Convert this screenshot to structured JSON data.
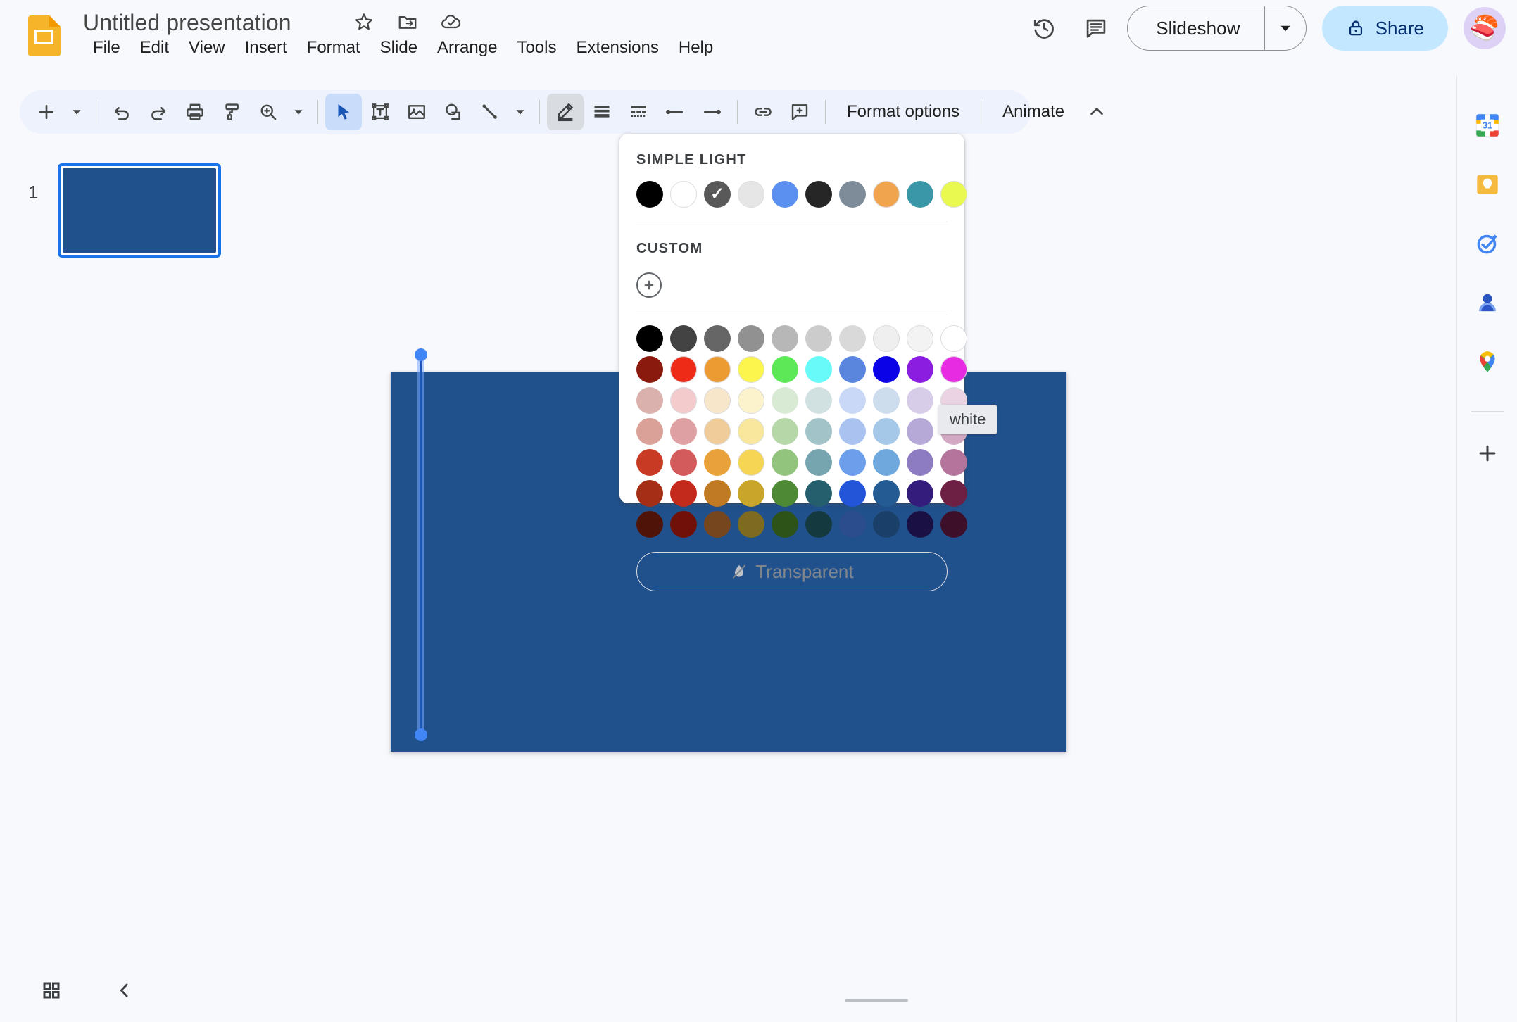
{
  "header": {
    "title": "Untitled presentation",
    "logo_icon": "slides-logo-icon",
    "title_icons": [
      {
        "name": "star-icon",
        "label": "Star"
      },
      {
        "name": "move-to-folder-icon",
        "label": "Move"
      },
      {
        "name": "cloud-saved-icon",
        "label": "Saved to Drive"
      }
    ],
    "menus": [
      "File",
      "Edit",
      "View",
      "Insert",
      "Format",
      "Slide",
      "Arrange",
      "Tools",
      "Extensions",
      "Help"
    ],
    "version_history_label": "Version history",
    "comment_label": "Open comment history",
    "slideshow_label": "Slideshow",
    "share_label": "Share",
    "avatar_emoji": "🍣"
  },
  "toolbar": {
    "new_slide_label": "New slide",
    "undo_label": "Undo",
    "redo_label": "Redo",
    "print_label": "Print",
    "paint_format_label": "Paint format",
    "zoom_label": "Zoom",
    "select_label": "Select",
    "textbox_label": "Text box",
    "image_label": "Insert image",
    "shape_label": "Shape",
    "line_label": "Line",
    "border_color_label": "Border color",
    "border_weight_label": "Border weight",
    "border_dash_label": "Border dash",
    "line_start_label": "Line start",
    "line_end_label": "Line end",
    "link_label": "Insert link",
    "comment_label": "Add comment",
    "format_options_label": "Format options",
    "animate_label": "Animate",
    "collapse_label": "Hide the menus"
  },
  "filmstrip": {
    "slides": [
      {
        "number": "1",
        "selected": true,
        "background": "#21518C"
      }
    ]
  },
  "canvas": {
    "slide_background": "#21518C",
    "selected_object": "vertical-line",
    "handle_color": "#4285f4"
  },
  "sidepanel": {
    "items": [
      {
        "name": "google-calendar-icon",
        "label": "Calendar"
      },
      {
        "name": "google-keep-icon",
        "label": "Keep"
      },
      {
        "name": "google-tasks-icon",
        "label": "Tasks"
      },
      {
        "name": "google-contacts-icon",
        "label": "Contacts"
      },
      {
        "name": "google-maps-icon",
        "label": "Maps"
      }
    ],
    "add_label": "Get add-ons"
  },
  "bottombar": {
    "grid_view_label": "Grid view",
    "collapse_label": "Hide filmstrip"
  },
  "color_picker": {
    "theme_label": "SIMPLE LIGHT",
    "custom_label": "CUSTOM",
    "custom_add_label": "Custom color",
    "transparent_label": "Transparent",
    "transparent_icon": "no-color-droplet-icon",
    "selected_index": 2,
    "tooltip": "white",
    "theme_colors": [
      "#000000",
      "#FFFFFF",
      "#595959",
      "#E7E6E6",
      "#5B8FF0",
      "#262626",
      "#7E8C9A",
      "#EFA44D",
      "#3A97A8",
      "#EAF94F"
    ],
    "grid_rows": [
      [
        "#000000",
        "#434343",
        "#666666",
        "#919191",
        "#B7B7B7",
        "#CCCCCC",
        "#D9D9D9",
        "#EFEFEF",
        "#F3F3F3",
        "#FFFFFF"
      ],
      [
        "#8B1A0E",
        "#EE2B17",
        "#EC9B32",
        "#FBF54E",
        "#5DE857",
        "#68F9F9",
        "#5A86DE",
        "#0B02E8",
        "#8B1DE0",
        "#E72BE2"
      ],
      [
        "#DAB1AC",
        "#F3CBCD",
        "#F8E6CB",
        "#FCF3CC",
        "#D9EAD4",
        "#D1E0E0",
        "#C8D8F6",
        "#CDDDEE",
        "#D7CDE9",
        "#EBD3E3"
      ],
      [
        "#D9A198",
        "#DFA0A3",
        "#F0CC9A",
        "#F9E79E",
        "#B6D7A7",
        "#A2C4C9",
        "#A9C2F0",
        "#A5C7E8",
        "#B6A9D7",
        "#D3A8C3"
      ],
      [
        "#C83A24",
        "#D35B5B",
        "#E9A css",
        "#F6D555",
        "#93C47D",
        "#76A5AF",
        "#6D9EEB",
        "#6FA8DC",
        "#8E7CC3",
        "#B4749B"
      ],
      [
        "#A42F16",
        "#C42A1B",
        "#C07A24",
        "#C9A52A",
        "#4E8A35",
        "#255F6D",
        "#2255D8",
        "#245B92",
        "#341C7D",
        "#6D1F44"
      ],
      [
        "#4F1407",
        "#701008",
        "#76471F",
        "#7E6A20",
        "#2E5318",
        "#143A3F",
        "#2B4D8E",
        "#1A4069",
        "#1B1044",
        "#3E0F28"
      ]
    ]
  }
}
